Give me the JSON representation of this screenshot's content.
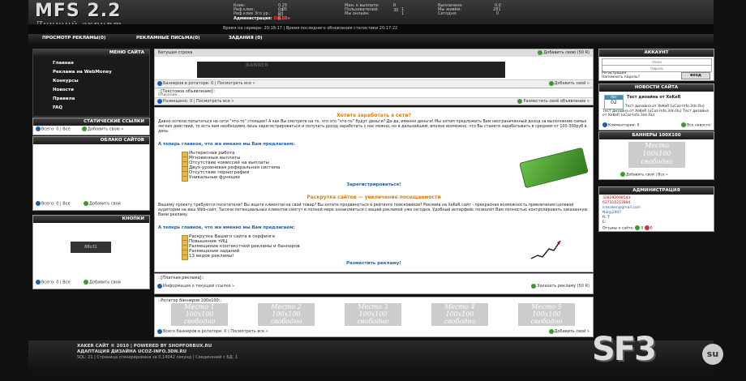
{
  "header": {
    "logo": "MFS 2.2",
    "slogan": "Лучший скрипт",
    "stats_col1": [
      {
        "label": "Клик:",
        "value": "0.25 - 0 R"
      },
      {
        "label": "Реф.клик:",
        "value": "0.05 - 3 R"
      },
      {
        "label": "Реф.клик 3го ур.:",
        "value": "R 0.03"
      }
    ],
    "stats_col2": [
      {
        "label": "Мин. к выплате:",
        "value": "R 30"
      },
      {
        "label": "Пользователей:",
        "value": "1"
      },
      {
        "label": "Мы онлайн:",
        "value": "1"
      }
    ],
    "stats_col3": [
      {
        "label": "Выплачено:",
        "value": "0.0"
      },
      {
        "label": "Мы живём:",
        "value": "281"
      },
      {
        "label": "Сегодня:",
        "value": "0"
      }
    ],
    "admin_label": "Администрация:",
    "admin_value": "Off line",
    "server_time": "Время на сервере: 20:18:17 | Время последнего обновления статистики 20:17:22"
  },
  "topnav": [
    "ПРОСМОТР РЕКЛАМЫ(0)",
    "РЕКЛАМНЫЕ ПИСЬМА(0)",
    "ЗАДАНИЯ (0)"
  ],
  "left": {
    "menu_title": "МЕНЮ САЙТА",
    "menu_items": [
      "Главная",
      "Реклама на WebMoney",
      "Конкурсы",
      "Новости",
      "Правила",
      "FAQ"
    ],
    "static_title": "СТАТИЧЕСКИЕ ССЫЛКИ",
    "static_footer": "Всего: 0 | Все",
    "static_add": "Добавить свою »",
    "cloud_title": "ОБЛАКО САЙТОВ",
    "cloud_footer": "Всего: 0 | Все",
    "cloud_add": "Добавить свой",
    "buttons_title": "КНОПКИ",
    "button_label": "88x31",
    "buttons_footer": "Всего: 0 | Все",
    "buttons_add": "Добавить свой"
  },
  "center": {
    "ticker_label": "Бегущая строка",
    "ticker_add": "Добавить свою (50 R)",
    "banner_text": "BANNER",
    "rotator_info": "Баннеров в ротаторе: 0 | Посмотреть все »",
    "rotator_add": "Добавить свой »",
    "text_ad_title": "::[Текстовое объявление]::",
    "text_ad_desc": "Описание...",
    "text_ad_info": "Размещено: 0 | Посмотреть все »",
    "text_ad_add": "Разместить своё объявление »",
    "earn_title": "Хотите заработать в сети?",
    "earn_text": "Давно хотели попытаться на сети \"что-то\" стоящее? А как Вы смотрите на то, что это \"что-то\" будут деньги? Да-да, именно деньги! Мы хотим предложить Вам неограниченный доход за выполнение самых легких действий, то есть вам необходимо лишь зарегистрироваться и получать доход заработать с нас можно, но в дальнейшем, вполне возможно, что Вы станете зарабатывать в среднем от 100-300руб в день.",
    "earn_offer": "А теперь главное, что же именно мы Вам предлагаем:",
    "earn_list": [
      "Интересная работа",
      "Мгновенные выплаты",
      "Отсутствие комиссий на выплаты",
      "Двух-уровневая реферальная система",
      "Отсутствие порнографии",
      "Уникальные функции"
    ],
    "register_link": "Зарегистрироваться!",
    "promo_title": "Раскрутка сайтов — увеличение посещаемости",
    "promo_text": "Вашему проекту требуются посетители? Вы ищете клиентов на свой товар? Вы хотите продвинуться в рейтинге поисковиков? Реклама на XeKeR сайт - прекрасная возможность привлечения целевой аудитории на ваш Web-сайт. Тысячи потенциальных клиентов смогут в полной мере ознакомиться с вашей рекламой уже сегодня. Удобный интерфейс позволит Вам полностью контролировать заказанную Вами рекламу.",
    "promo_offer": "А теперь главное, что же именно мы Вам предлагаем:",
    "promo_list": [
      "Раскрутка Вашего сайта в серфинге",
      "Повышение тИЦ",
      "Размещение контекстной рекламы и баннеров",
      "Размещение заданий",
      "13 видов рекламы!"
    ],
    "promo_link": "Разместить рекламу!",
    "paid_title": "::[Платная реклама]::",
    "paid_info": "Информация о текущей ссылке »",
    "paid_add": "Заказать рекламу (50 R)",
    "rotator100_title": "::Ротатор баннеров 100x100::",
    "banners100": [
      {
        "title": "Место 1",
        "line1": "100x100",
        "line2": "свободно"
      },
      {
        "title": "Место 2",
        "line1": "100x100",
        "line2": "свободно"
      },
      {
        "title": "Место 3",
        "line1": "100x100",
        "line2": "свободно"
      },
      {
        "title": "Место 4",
        "line1": "100x100",
        "line2": "свободно"
      },
      {
        "title": "Место 5",
        "line1": "100x100",
        "line2": "свободно"
      }
    ],
    "rotator100_info": "Всего баннеров в ротаторе: 0 | Посмотреть все »",
    "rotator100_add": "Добавить свой »"
  },
  "right": {
    "account_title": "АККАУНТ",
    "login_placeholder": "Логин",
    "password_placeholder": "Пароль",
    "register_link": "Регистрация",
    "forgot_link": "Напомнить пароль?",
    "login_button": "вход",
    "news_title": "НОВОСТИ САЙТА",
    "news_month": "Авг",
    "news_day": "02",
    "news_headline": "Тест дизайна от XeKeR",
    "news_text": "Тест дизайна от XeKeR (uCoz-Info.3dn.Ru) Тест дизайна от XeKeR (uCoz-Info.3dn.Ru) Тест дизайна от XeKeR (uCoz-Info.3dn.Ru)",
    "news_comments": "Комментарии: 0",
    "news_all": "Все новости",
    "banners_title": "БАННЕРЫ 100X100",
    "banner_title": "Место",
    "banner_line1": "100x100",
    "banner_line2": "свободно",
    "banners_add": "Добавить свой | Все »",
    "admin_title": "АДМИНИСТРАЦИЯ",
    "admin_contacts": [
      "328292098543",
      "637310213894",
      "icexaker@gmail.com",
      "Nik@2907",
      "R:",
      "Е:"
    ],
    "admin_r_value": "7",
    "admin_feedback": "Отзывы о сайте:",
    "feedback_pos": "0",
    "feedback_neg": "0"
  },
  "footer": {
    "line1": "XAKER САЙТ © 2010 | POWERED BY SHOPFORBUX.RU",
    "line2": "АДАПТАЦИЯ ДИЗАЙНА UCOZ-INFO.3DN.RU",
    "line3": "SQL: 21 | Страница сгенерирована за 0,14042 секунд | Соединений с БД: 1",
    "watermark": "SF3",
    "watermark_sub": "su"
  },
  "colors": {
    "accent_orange": "#e87a00",
    "link_blue": "#1a5fb4",
    "green": "#3b9a2b",
    "dark_bg": "#111111"
  }
}
